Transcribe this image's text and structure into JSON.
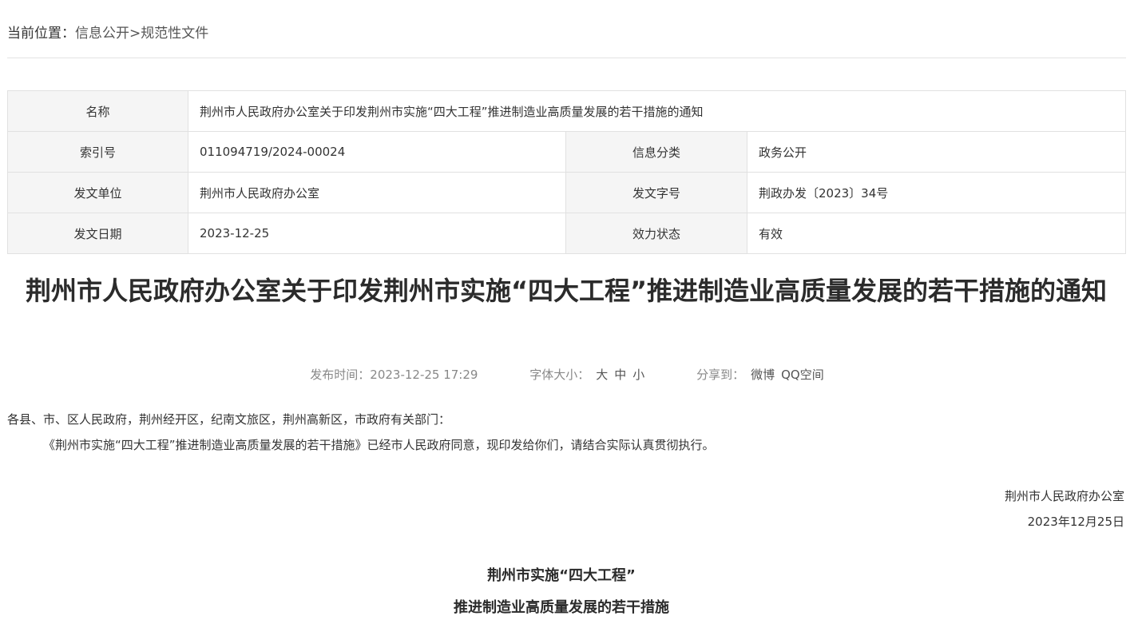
{
  "breadcrumb": {
    "label": "当前位置：",
    "items": [
      "信息公开",
      "规范性文件"
    ],
    "separator": ">"
  },
  "meta": {
    "name_label": "名称",
    "name_value": "荆州市人民政府办公室关于印发荆州市实施“四大工程”推进制造业高质量发展的若干措施的通知",
    "index_label": "索引号",
    "index_value": "011094719/2024-00024",
    "category_label": "信息分类",
    "category_value": "政务公开",
    "issuer_label": "发文单位",
    "issuer_value": "荆州市人民政府办公室",
    "doc_no_label": "发文字号",
    "doc_no_value": "荆政办发〔2023〕34号",
    "date_label": "发文日期",
    "date_value": "2023-12-25",
    "status_label": "效力状态",
    "status_value": "有效"
  },
  "article": {
    "title": "荆州市人民政府办公室关于印发荆州市实施“四大工程”推进制造业高质量发展的若干措施的通知",
    "publish_label": "发布时间：",
    "publish_time": "2023-12-25 17:29",
    "font_size_label": "字体大小：",
    "font_sizes": [
      "大",
      "中",
      "小"
    ],
    "share_label": "分享到：",
    "share_targets": [
      "微博",
      "QQ空间"
    ],
    "salutation": "各县、市、区人民政府，荆州经开区，纪南文旅区，荆州高新区，市政府有关部门：",
    "paragraph1": "《荆州市实施“四大工程”推进制造业高质量发展的若干措施》已经市人民政府同意，现印发给你们，请结合实际认真贯彻执行。",
    "sign_org": "荆州市人民政府办公室",
    "sign_date": "2023年12月25日",
    "sub_title_1": "荆州市实施“四大工程”",
    "sub_title_2": "推进制造业高质量发展的若干措施"
  },
  "colors": {
    "text": "#333333",
    "muted": "#888888",
    "border": "#e1e1e1",
    "label_bg": "#f5f5f5"
  }
}
